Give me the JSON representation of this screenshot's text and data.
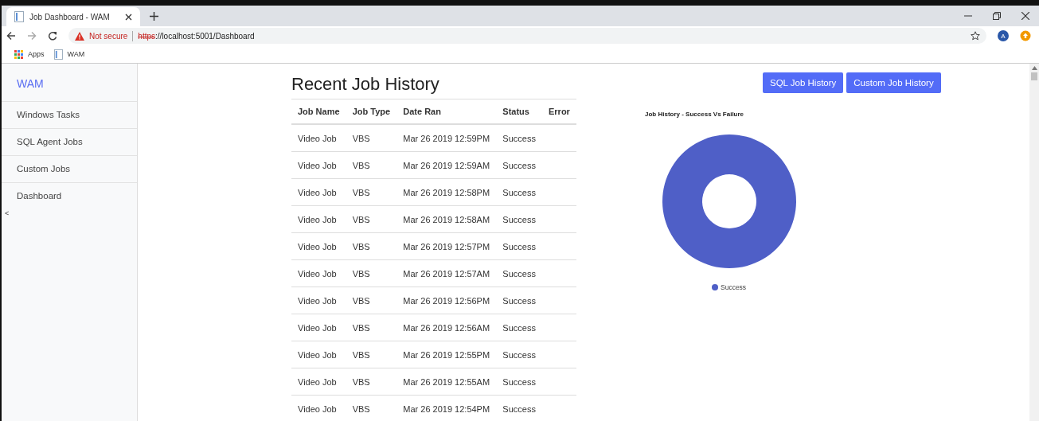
{
  "browser": {
    "tab_title": "Job Dashboard - WAM",
    "security": "Not secure",
    "url_scheme": "https",
    "url_rest": "://localhost:5001/Dashboard",
    "profile_initial": "A",
    "bookmarks": [
      "Apps",
      "WAM"
    ]
  },
  "sidebar": {
    "brand": "WAM",
    "items": [
      "Windows Tasks",
      "SQL Agent Jobs",
      "Custom Jobs",
      "Dashboard"
    ],
    "collapse": "<"
  },
  "history": {
    "title": "Recent Job History",
    "columns": [
      "Job Name",
      "Job Type",
      "Date Ran",
      "Status",
      "Error"
    ],
    "rows": [
      [
        "Video Job",
        "VBS",
        "Mar 26 2019 12:59PM",
        "Success"
      ],
      [
        "Video Job",
        "VBS",
        "Mar 26 2019 12:59AM",
        "Success"
      ],
      [
        "Video Job",
        "VBS",
        "Mar 26 2019 12:58PM",
        "Success"
      ],
      [
        "Video Job",
        "VBS",
        "Mar 26 2019 12:58AM",
        "Success"
      ],
      [
        "Video Job",
        "VBS",
        "Mar 26 2019 12:57PM",
        "Success"
      ],
      [
        "Video Job",
        "VBS",
        "Mar 26 2019 12:57AM",
        "Success"
      ],
      [
        "Video Job",
        "VBS",
        "Mar 26 2019 12:56PM",
        "Success"
      ],
      [
        "Video Job",
        "VBS",
        "Mar 26 2019 12:56AM",
        "Success"
      ],
      [
        "Video Job",
        "VBS",
        "Mar 26 2019 12:55PM",
        "Success"
      ],
      [
        "Video Job",
        "VBS",
        "Mar 26 2019 12:55AM",
        "Success"
      ],
      [
        "Video Job",
        "VBS",
        "Mar 26 2019 12:54PM",
        "Success"
      ]
    ]
  },
  "buttons": [
    "SQL Job History",
    "Custom Job History"
  ],
  "chart": {
    "title": "Job History - Success Vs Failure",
    "legend": [
      {
        "label": "Success",
        "color": "#4f5fc7"
      }
    ]
  }
}
